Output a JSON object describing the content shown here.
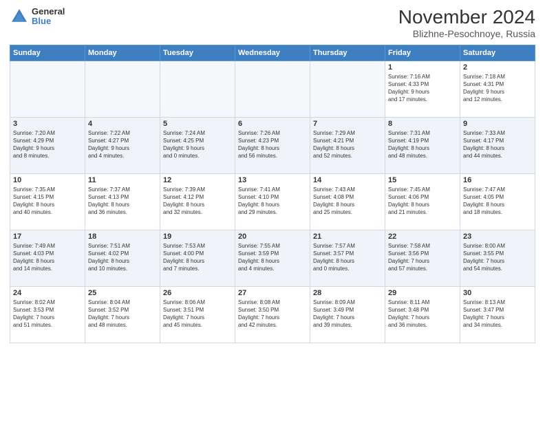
{
  "header": {
    "logo_line1": "General",
    "logo_line2": "Blue",
    "month_title": "November 2024",
    "subtitle": "Blizhne-Pesochnoye, Russia"
  },
  "days_of_week": [
    "Sunday",
    "Monday",
    "Tuesday",
    "Wednesday",
    "Thursday",
    "Friday",
    "Saturday"
  ],
  "weeks": [
    [
      {
        "day": "",
        "info": ""
      },
      {
        "day": "",
        "info": ""
      },
      {
        "day": "",
        "info": ""
      },
      {
        "day": "",
        "info": ""
      },
      {
        "day": "",
        "info": ""
      },
      {
        "day": "1",
        "info": "Sunrise: 7:16 AM\nSunset: 4:33 PM\nDaylight: 9 hours\nand 17 minutes."
      },
      {
        "day": "2",
        "info": "Sunrise: 7:18 AM\nSunset: 4:31 PM\nDaylight: 9 hours\nand 12 minutes."
      }
    ],
    [
      {
        "day": "3",
        "info": "Sunrise: 7:20 AM\nSunset: 4:29 PM\nDaylight: 9 hours\nand 8 minutes."
      },
      {
        "day": "4",
        "info": "Sunrise: 7:22 AM\nSunset: 4:27 PM\nDaylight: 9 hours\nand 4 minutes."
      },
      {
        "day": "5",
        "info": "Sunrise: 7:24 AM\nSunset: 4:25 PM\nDaylight: 9 hours\nand 0 minutes."
      },
      {
        "day": "6",
        "info": "Sunrise: 7:26 AM\nSunset: 4:23 PM\nDaylight: 8 hours\nand 56 minutes."
      },
      {
        "day": "7",
        "info": "Sunrise: 7:29 AM\nSunset: 4:21 PM\nDaylight: 8 hours\nand 52 minutes."
      },
      {
        "day": "8",
        "info": "Sunrise: 7:31 AM\nSunset: 4:19 PM\nDaylight: 8 hours\nand 48 minutes."
      },
      {
        "day": "9",
        "info": "Sunrise: 7:33 AM\nSunset: 4:17 PM\nDaylight: 8 hours\nand 44 minutes."
      }
    ],
    [
      {
        "day": "10",
        "info": "Sunrise: 7:35 AM\nSunset: 4:15 PM\nDaylight: 8 hours\nand 40 minutes."
      },
      {
        "day": "11",
        "info": "Sunrise: 7:37 AM\nSunset: 4:13 PM\nDaylight: 8 hours\nand 36 minutes."
      },
      {
        "day": "12",
        "info": "Sunrise: 7:39 AM\nSunset: 4:12 PM\nDaylight: 8 hours\nand 32 minutes."
      },
      {
        "day": "13",
        "info": "Sunrise: 7:41 AM\nSunset: 4:10 PM\nDaylight: 8 hours\nand 29 minutes."
      },
      {
        "day": "14",
        "info": "Sunrise: 7:43 AM\nSunset: 4:08 PM\nDaylight: 8 hours\nand 25 minutes."
      },
      {
        "day": "15",
        "info": "Sunrise: 7:45 AM\nSunset: 4:06 PM\nDaylight: 8 hours\nand 21 minutes."
      },
      {
        "day": "16",
        "info": "Sunrise: 7:47 AM\nSunset: 4:05 PM\nDaylight: 8 hours\nand 18 minutes."
      }
    ],
    [
      {
        "day": "17",
        "info": "Sunrise: 7:49 AM\nSunset: 4:03 PM\nDaylight: 8 hours\nand 14 minutes."
      },
      {
        "day": "18",
        "info": "Sunrise: 7:51 AM\nSunset: 4:02 PM\nDaylight: 8 hours\nand 10 minutes."
      },
      {
        "day": "19",
        "info": "Sunrise: 7:53 AM\nSunset: 4:00 PM\nDaylight: 8 hours\nand 7 minutes."
      },
      {
        "day": "20",
        "info": "Sunrise: 7:55 AM\nSunset: 3:59 PM\nDaylight: 8 hours\nand 4 minutes."
      },
      {
        "day": "21",
        "info": "Sunrise: 7:57 AM\nSunset: 3:57 PM\nDaylight: 8 hours\nand 0 minutes."
      },
      {
        "day": "22",
        "info": "Sunrise: 7:58 AM\nSunset: 3:56 PM\nDaylight: 7 hours\nand 57 minutes."
      },
      {
        "day": "23",
        "info": "Sunrise: 8:00 AM\nSunset: 3:55 PM\nDaylight: 7 hours\nand 54 minutes."
      }
    ],
    [
      {
        "day": "24",
        "info": "Sunrise: 8:02 AM\nSunset: 3:53 PM\nDaylight: 7 hours\nand 51 minutes."
      },
      {
        "day": "25",
        "info": "Sunrise: 8:04 AM\nSunset: 3:52 PM\nDaylight: 7 hours\nand 48 minutes."
      },
      {
        "day": "26",
        "info": "Sunrise: 8:06 AM\nSunset: 3:51 PM\nDaylight: 7 hours\nand 45 minutes."
      },
      {
        "day": "27",
        "info": "Sunrise: 8:08 AM\nSunset: 3:50 PM\nDaylight: 7 hours\nand 42 minutes."
      },
      {
        "day": "28",
        "info": "Sunrise: 8:09 AM\nSunset: 3:49 PM\nDaylight: 7 hours\nand 39 minutes."
      },
      {
        "day": "29",
        "info": "Sunrise: 8:11 AM\nSunset: 3:48 PM\nDaylight: 7 hours\nand 36 minutes."
      },
      {
        "day": "30",
        "info": "Sunrise: 8:13 AM\nSunset: 3:47 PM\nDaylight: 7 hours\nand 34 minutes."
      }
    ]
  ]
}
